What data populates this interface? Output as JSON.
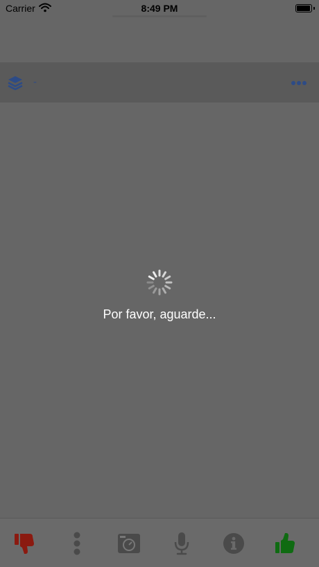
{
  "status_bar": {
    "carrier": "Carrier",
    "time": "8:49 PM"
  },
  "layer_bar": {
    "layer_name": "-",
    "icons": [
      "layers-icon",
      "more-icon"
    ]
  },
  "loading": {
    "message": "Por favor, aguarde..."
  },
  "toolbar": {
    "items": [
      {
        "name": "thumbs-down-icon",
        "color": "#8b1a10"
      },
      {
        "name": "vertical-dots-icon",
        "color": "#4a4a4a"
      },
      {
        "name": "camera-icon",
        "color": "#4a4a4a"
      },
      {
        "name": "microphone-icon",
        "color": "#4a4a4a"
      },
      {
        "name": "info-icon",
        "color": "#4a4a4a"
      },
      {
        "name": "thumbs-up-icon",
        "color": "#0f6b12"
      }
    ]
  },
  "colors": {
    "background": "#666666",
    "accent": "#2d4b86",
    "negative": "#8b1a10",
    "positive": "#0f6b12"
  }
}
